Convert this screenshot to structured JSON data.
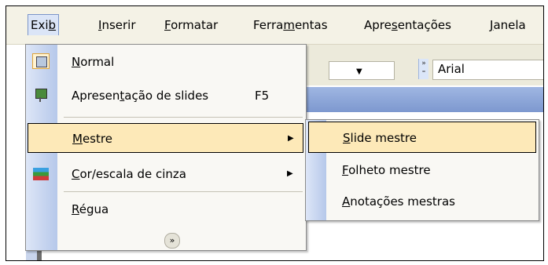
{
  "menubar": {
    "items": [
      {
        "pre": "Exi",
        "acc": "b",
        "post": ""
      },
      {
        "pre": "",
        "acc": "I",
        "post": "nserir"
      },
      {
        "pre": "",
        "acc": "F",
        "post": "ormatar"
      },
      {
        "pre": "Ferra",
        "acc": "m",
        "post": "entas"
      },
      {
        "pre": "Apre",
        "acc": "s",
        "post": "entações"
      },
      {
        "pre": "",
        "acc": "J",
        "post": "anela"
      }
    ]
  },
  "toolbar": {
    "font_name": "Arial"
  },
  "view_menu": {
    "items": [
      {
        "pre": "",
        "acc": "N",
        "post": "ormal",
        "shortcut": "",
        "icon": "normal-view-icon"
      },
      {
        "pre": "Apresen",
        "acc": "t",
        "post": "ação de slides",
        "shortcut": "F5",
        "icon": "slideshow-icon"
      },
      {
        "pre": "",
        "acc": "M",
        "post": "estre",
        "shortcut": "",
        "icon": ""
      },
      {
        "pre": "",
        "acc": "C",
        "post": "or/escala de cinza",
        "shortcut": "",
        "icon": "color-grayscale-icon"
      },
      {
        "pre": "",
        "acc": "R",
        "post": "égua",
        "shortcut": "",
        "icon": ""
      }
    ]
  },
  "master_submenu": {
    "items": [
      {
        "pre": "",
        "acc": "S",
        "post": "lide mestre"
      },
      {
        "pre": "",
        "acc": "F",
        "post": "olheto mestre"
      },
      {
        "pre": "",
        "acc": "A",
        "post": "notações mestras"
      }
    ]
  }
}
